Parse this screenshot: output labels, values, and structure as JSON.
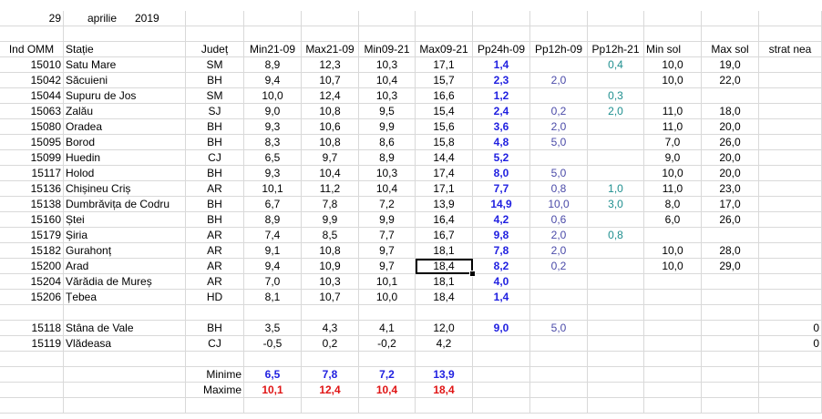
{
  "date_row": {
    "day": "29",
    "month": "aprilie",
    "year": "2019"
  },
  "headers": [
    "Ind OMM",
    "Stație",
    "Județ",
    "Min21-09",
    "Max21-09",
    "Min09-21",
    "Max09-21",
    "Pp24h-09",
    "Pp12h-09",
    "Pp12h-21",
    "Min sol",
    "Max sol",
    "strat nea"
  ],
  "stations": [
    {
      "ind": "15010",
      "name": "Satu Mare",
      "county": "SM",
      "min2109": "8,9",
      "max2109": "12,3",
      "min0921": "10,3",
      "max0921": "17,1",
      "pp24": "1,4",
      "pp12_09": "",
      "pp12_21": "0,4",
      "minsol": "10,0",
      "maxsol": "19,0",
      "snow": ""
    },
    {
      "ind": "15042",
      "name": "Săcuieni",
      "county": "BH",
      "min2109": "9,4",
      "max2109": "10,7",
      "min0921": "10,4",
      "max0921": "15,7",
      "pp24": "2,3",
      "pp12_09": "2,0",
      "pp12_21": "",
      "minsol": "10,0",
      "maxsol": "22,0",
      "snow": ""
    },
    {
      "ind": "15044",
      "name": "Supuru de Jos",
      "county": "SM",
      "min2109": "10,0",
      "max2109": "12,4",
      "min0921": "10,3",
      "max0921": "16,6",
      "pp24": "1,2",
      "pp12_09": "",
      "pp12_21": "0,3",
      "minsol": "",
      "maxsol": "",
      "snow": ""
    },
    {
      "ind": "15063",
      "name": "Zalău",
      "county": "SJ",
      "min2109": "9,0",
      "max2109": "10,8",
      "min0921": "9,5",
      "max0921": "15,4",
      "pp24": "2,4",
      "pp12_09": "0,2",
      "pp12_21": "2,0",
      "minsol": "11,0",
      "maxsol": "18,0",
      "snow": ""
    },
    {
      "ind": "15080",
      "name": "Oradea",
      "county": "BH",
      "min2109": "9,3",
      "max2109": "10,6",
      "min0921": "9,9",
      "max0921": "15,6",
      "pp24": "3,6",
      "pp12_09": "2,0",
      "pp12_21": "",
      "minsol": "11,0",
      "maxsol": "20,0",
      "snow": ""
    },
    {
      "ind": "15095",
      "name": "Borod",
      "county": "BH",
      "min2109": "8,3",
      "max2109": "10,8",
      "min0921": "8,6",
      "max0921": "15,8",
      "pp24": "4,8",
      "pp12_09": "5,0",
      "pp12_21": "",
      "minsol": "7,0",
      "maxsol": "26,0",
      "snow": ""
    },
    {
      "ind": "15099",
      "name": "Huedin",
      "county": "CJ",
      "min2109": "6,5",
      "max2109": "9,7",
      "min0921": "8,9",
      "max0921": "14,4",
      "pp24": "5,2",
      "pp12_09": "",
      "pp12_21": "",
      "minsol": "9,0",
      "maxsol": "20,0",
      "snow": ""
    },
    {
      "ind": "15117",
      "name": "Holod",
      "county": "BH",
      "min2109": "9,3",
      "max2109": "10,4",
      "min0921": "10,3",
      "max0921": "17,4",
      "pp24": "8,0",
      "pp12_09": "5,0",
      "pp12_21": "",
      "minsol": "10,0",
      "maxsol": "20,0",
      "snow": ""
    },
    {
      "ind": "15136",
      "name": "Chișineu    Criș",
      "county": "AR",
      "min2109": "10,1",
      "max2109": "11,2",
      "min0921": "10,4",
      "max0921": "17,1",
      "pp24": "7,7",
      "pp12_09": "0,8",
      "pp12_21": "1,0",
      "minsol": "11,0",
      "maxsol": "23,0",
      "snow": ""
    },
    {
      "ind": "15138",
      "name": "Dumbrăvița de Codru",
      "county": "BH",
      "min2109": "6,7",
      "max2109": "7,8",
      "min0921": "7,2",
      "max0921": "13,9",
      "pp24": "14,9",
      "pp12_09": "10,0",
      "pp12_21": "3,0",
      "minsol": "8,0",
      "maxsol": "17,0",
      "snow": ""
    },
    {
      "ind": "15160",
      "name": "Ștei",
      "county": "BH",
      "min2109": "8,9",
      "max2109": "9,9",
      "min0921": "9,9",
      "max0921": "16,4",
      "pp24": "4,2",
      "pp12_09": "0,6",
      "pp12_21": "",
      "minsol": "6,0",
      "maxsol": "26,0",
      "snow": ""
    },
    {
      "ind": "15179",
      "name": "Șiria",
      "county": "AR",
      "min2109": "7,4",
      "max2109": "8,5",
      "min0921": "7,7",
      "max0921": "16,7",
      "pp24": "9,8",
      "pp12_09": "2,0",
      "pp12_21": "0,8",
      "minsol": "",
      "maxsol": "",
      "snow": ""
    },
    {
      "ind": "15182",
      "name": "Gurahonț",
      "county": "AR",
      "min2109": "9,1",
      "max2109": "10,8",
      "min0921": "9,7",
      "max0921": "18,1",
      "pp24": "7,8",
      "pp12_09": "2,0",
      "pp12_21": "",
      "minsol": "10,0",
      "maxsol": "28,0",
      "snow": ""
    },
    {
      "ind": "15200",
      "name": "Arad",
      "county": "AR",
      "min2109": "9,4",
      "max2109": "10,9",
      "min0921": "9,7",
      "max0921": "18,4",
      "pp24": "8,2",
      "pp12_09": "0,2",
      "pp12_21": "",
      "minsol": "10,0",
      "maxsol": "29,0",
      "snow": ""
    },
    {
      "ind": "15204",
      "name": "Vărădia de Mureș",
      "county": "AR",
      "min2109": "7,0",
      "max2109": "10,3",
      "min0921": "10,1",
      "max0921": "18,1",
      "pp24": "4,0",
      "pp12_09": "",
      "pp12_21": "",
      "minsol": "",
      "maxsol": "",
      "snow": ""
    },
    {
      "ind": "15206",
      "name": "Țebea",
      "county": "HD",
      "min2109": "8,1",
      "max2109": "10,7",
      "min0921": "10,0",
      "max0921": "18,4",
      "pp24": "1,4",
      "pp12_09": "",
      "pp12_21": "",
      "minsol": "",
      "maxsol": "",
      "snow": ""
    }
  ],
  "mountain_stations": [
    {
      "ind": "15118",
      "name": "Stâna de Vale",
      "county": "BH",
      "min2109": "3,5",
      "max2109": "4,3",
      "min0921": "4,1",
      "max0921": "12,0",
      "pp24": "9,0",
      "pp12_09": "5,0",
      "pp12_21": "",
      "minsol": "",
      "maxsol": "",
      "snow": "0"
    },
    {
      "ind": "15119",
      "name": "Vlădeasa",
      "county": "CJ",
      "min2109": "-0,5",
      "max2109": "0,2",
      "min0921": "-0,2",
      "max0921": "4,2",
      "pp24": "",
      "pp12_09": "",
      "pp12_21": "",
      "minsol": "",
      "maxsol": "",
      "snow": "0"
    }
  ],
  "summary": {
    "min_label": "Minime",
    "max_label": "Maxime",
    "min_values": [
      "6,5",
      "7,8",
      "7,2",
      "13,9"
    ],
    "max_values": [
      "10,1",
      "12,4",
      "10,4",
      "18,4"
    ]
  },
  "selected_cell": "Max09-21 / 15200 Arad",
  "colors": {
    "gridline": "#d9d9d9",
    "precip": "#1f1fe0",
    "max_red": "#e01515",
    "pp12_21": "#1f8f8f",
    "pp12_09": "#4a4aa8"
  }
}
